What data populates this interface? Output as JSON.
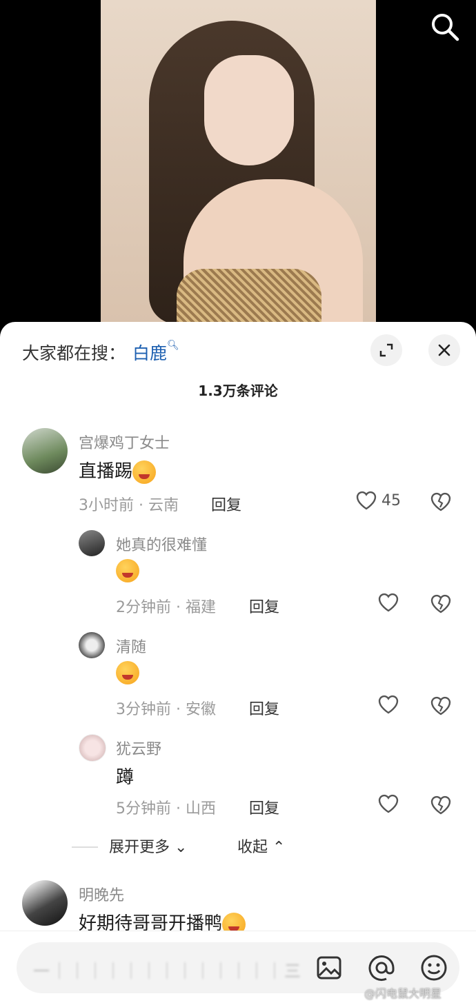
{
  "hot_search": {
    "label": "大家都在搜：",
    "term": "白鹿"
  },
  "comments_title": "1.3万条评论",
  "comments": [
    {
      "user": "宫爆鸡丁女士",
      "text": "直播踢",
      "time": "3小时前",
      "location": "云南",
      "reply": "回复",
      "likes": "45"
    }
  ],
  "replies": [
    {
      "user": "她真的很难懂",
      "text": "",
      "time": "2分钟前",
      "location": "福建",
      "reply": "回复"
    },
    {
      "user": "清随",
      "text": "",
      "time": "3分钟前",
      "location": "安徽",
      "reply": "回复"
    },
    {
      "user": "犹云野",
      "text": "蹲",
      "time": "5分钟前",
      "location": "山西",
      "reply": "回复"
    }
  ],
  "expand_more": "展开更多",
  "collapse": "收起",
  "next_comment": {
    "user": "明晚先",
    "text": "好期待哥哥开播鸭"
  },
  "input_placeholder": "一｜｜｜｜｜｜｜｜｜｜｜｜｜三",
  "watermark": "@闪电鼠大明星",
  "colors": {
    "link": "#1c5fb0",
    "sheet_bg": "#ffffff"
  },
  "icons": [
    "search-icon",
    "expand-icon",
    "close-icon",
    "heart-icon",
    "broken-heart-icon",
    "image-icon",
    "at-icon",
    "emoji-icon"
  ]
}
